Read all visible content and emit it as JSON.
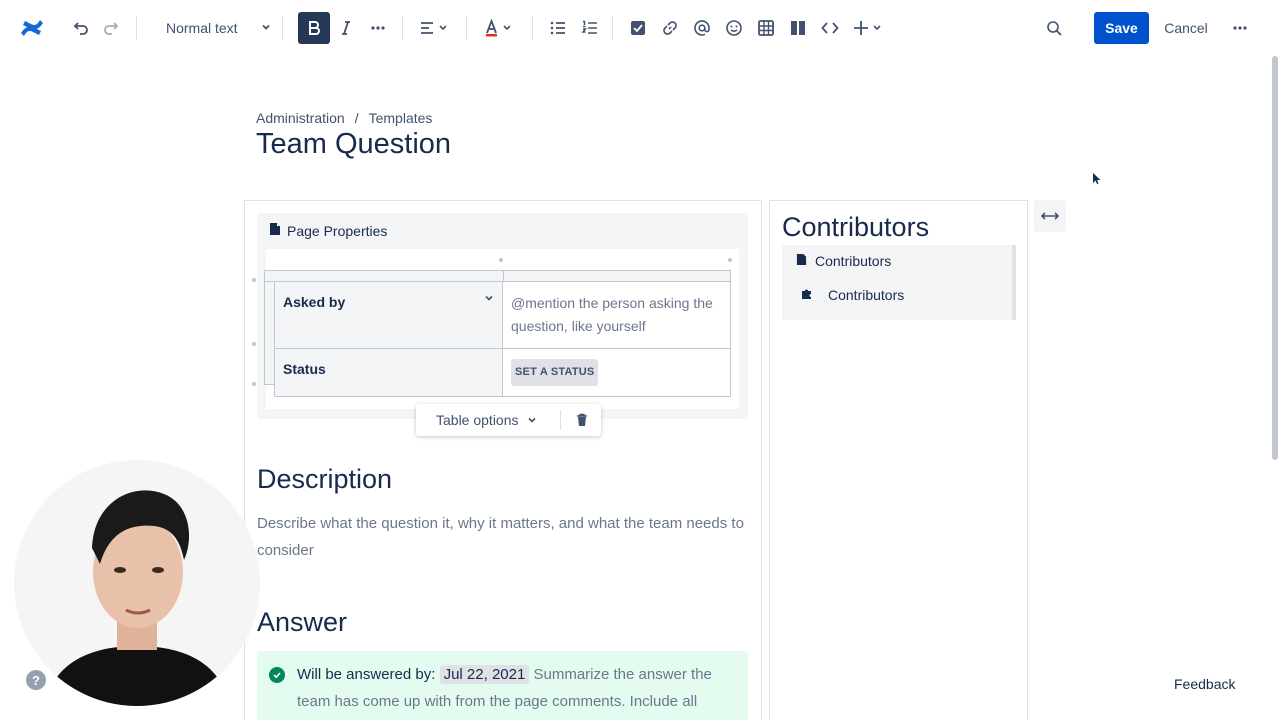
{
  "toolbar": {
    "text_style": "Normal text",
    "save_label": "Save",
    "cancel_label": "Cancel"
  },
  "breadcrumb": [
    "Administration",
    "Templates"
  ],
  "breadcrumb_separator": "/",
  "page_title": "Team Question",
  "page_properties": {
    "title": "Page Properties",
    "rows": [
      {
        "label": "Asked by",
        "value": "@mention the person asking the question, like yourself"
      },
      {
        "label": "Status",
        "value": "SET A STATUS"
      }
    ]
  },
  "table_options_label": "Table options",
  "description": {
    "heading": "Description",
    "body": "Describe what the question it, why it matters, and what the team needs to consider"
  },
  "answer": {
    "heading": "Answer",
    "lead": "Will be answered by:",
    "date": "Jul 22, 2021",
    "body": "Summarize the answer the team has come up with from the page comments. Include all"
  },
  "contributors": {
    "title": "Contributors",
    "items": [
      "Contributors",
      "Contributors"
    ]
  },
  "feedback_label": "Feedback",
  "help_label": "?",
  "colors": {
    "primary": "#0052cc",
    "text": "#172b4d",
    "muted": "#6b778c",
    "success": "#00875a",
    "success_bg": "#e3fcef"
  }
}
